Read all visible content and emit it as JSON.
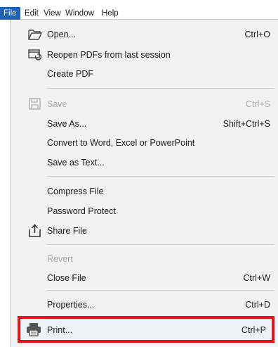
{
  "menubar": {
    "file": "File",
    "edit": "Edit",
    "view": "View",
    "window": "Window",
    "help": "Help"
  },
  "menu": {
    "open": {
      "label": "Open...",
      "shortcut": "Ctrl+O",
      "icon": "folder-open-icon"
    },
    "reopen": {
      "label": "Reopen PDFs from last session",
      "icon": "reopen-icon"
    },
    "create_pdf": {
      "label": "Create PDF"
    },
    "save": {
      "label": "Save",
      "shortcut": "Ctrl+S",
      "icon": "save-icon",
      "disabled": true
    },
    "save_as": {
      "label": "Save As...",
      "shortcut": "Shift+Ctrl+S"
    },
    "convert": {
      "label": "Convert to Word, Excel or PowerPoint"
    },
    "save_text": {
      "label": "Save as Text..."
    },
    "compress": {
      "label": "Compress File"
    },
    "password": {
      "label": "Password Protect"
    },
    "share": {
      "label": "Share File",
      "icon": "share-icon"
    },
    "revert": {
      "label": "Revert",
      "disabled": true
    },
    "close": {
      "label": "Close File",
      "shortcut": "Ctrl+W"
    },
    "properties": {
      "label": "Properties...",
      "shortcut": "Ctrl+D"
    },
    "print": {
      "label": "Print...",
      "shortcut": "Ctrl+P",
      "icon": "printer-icon"
    }
  },
  "colors": {
    "accent": "#1f62b8",
    "highlight_border": "#e8141b",
    "menu_bg": "#f2f2f2"
  }
}
